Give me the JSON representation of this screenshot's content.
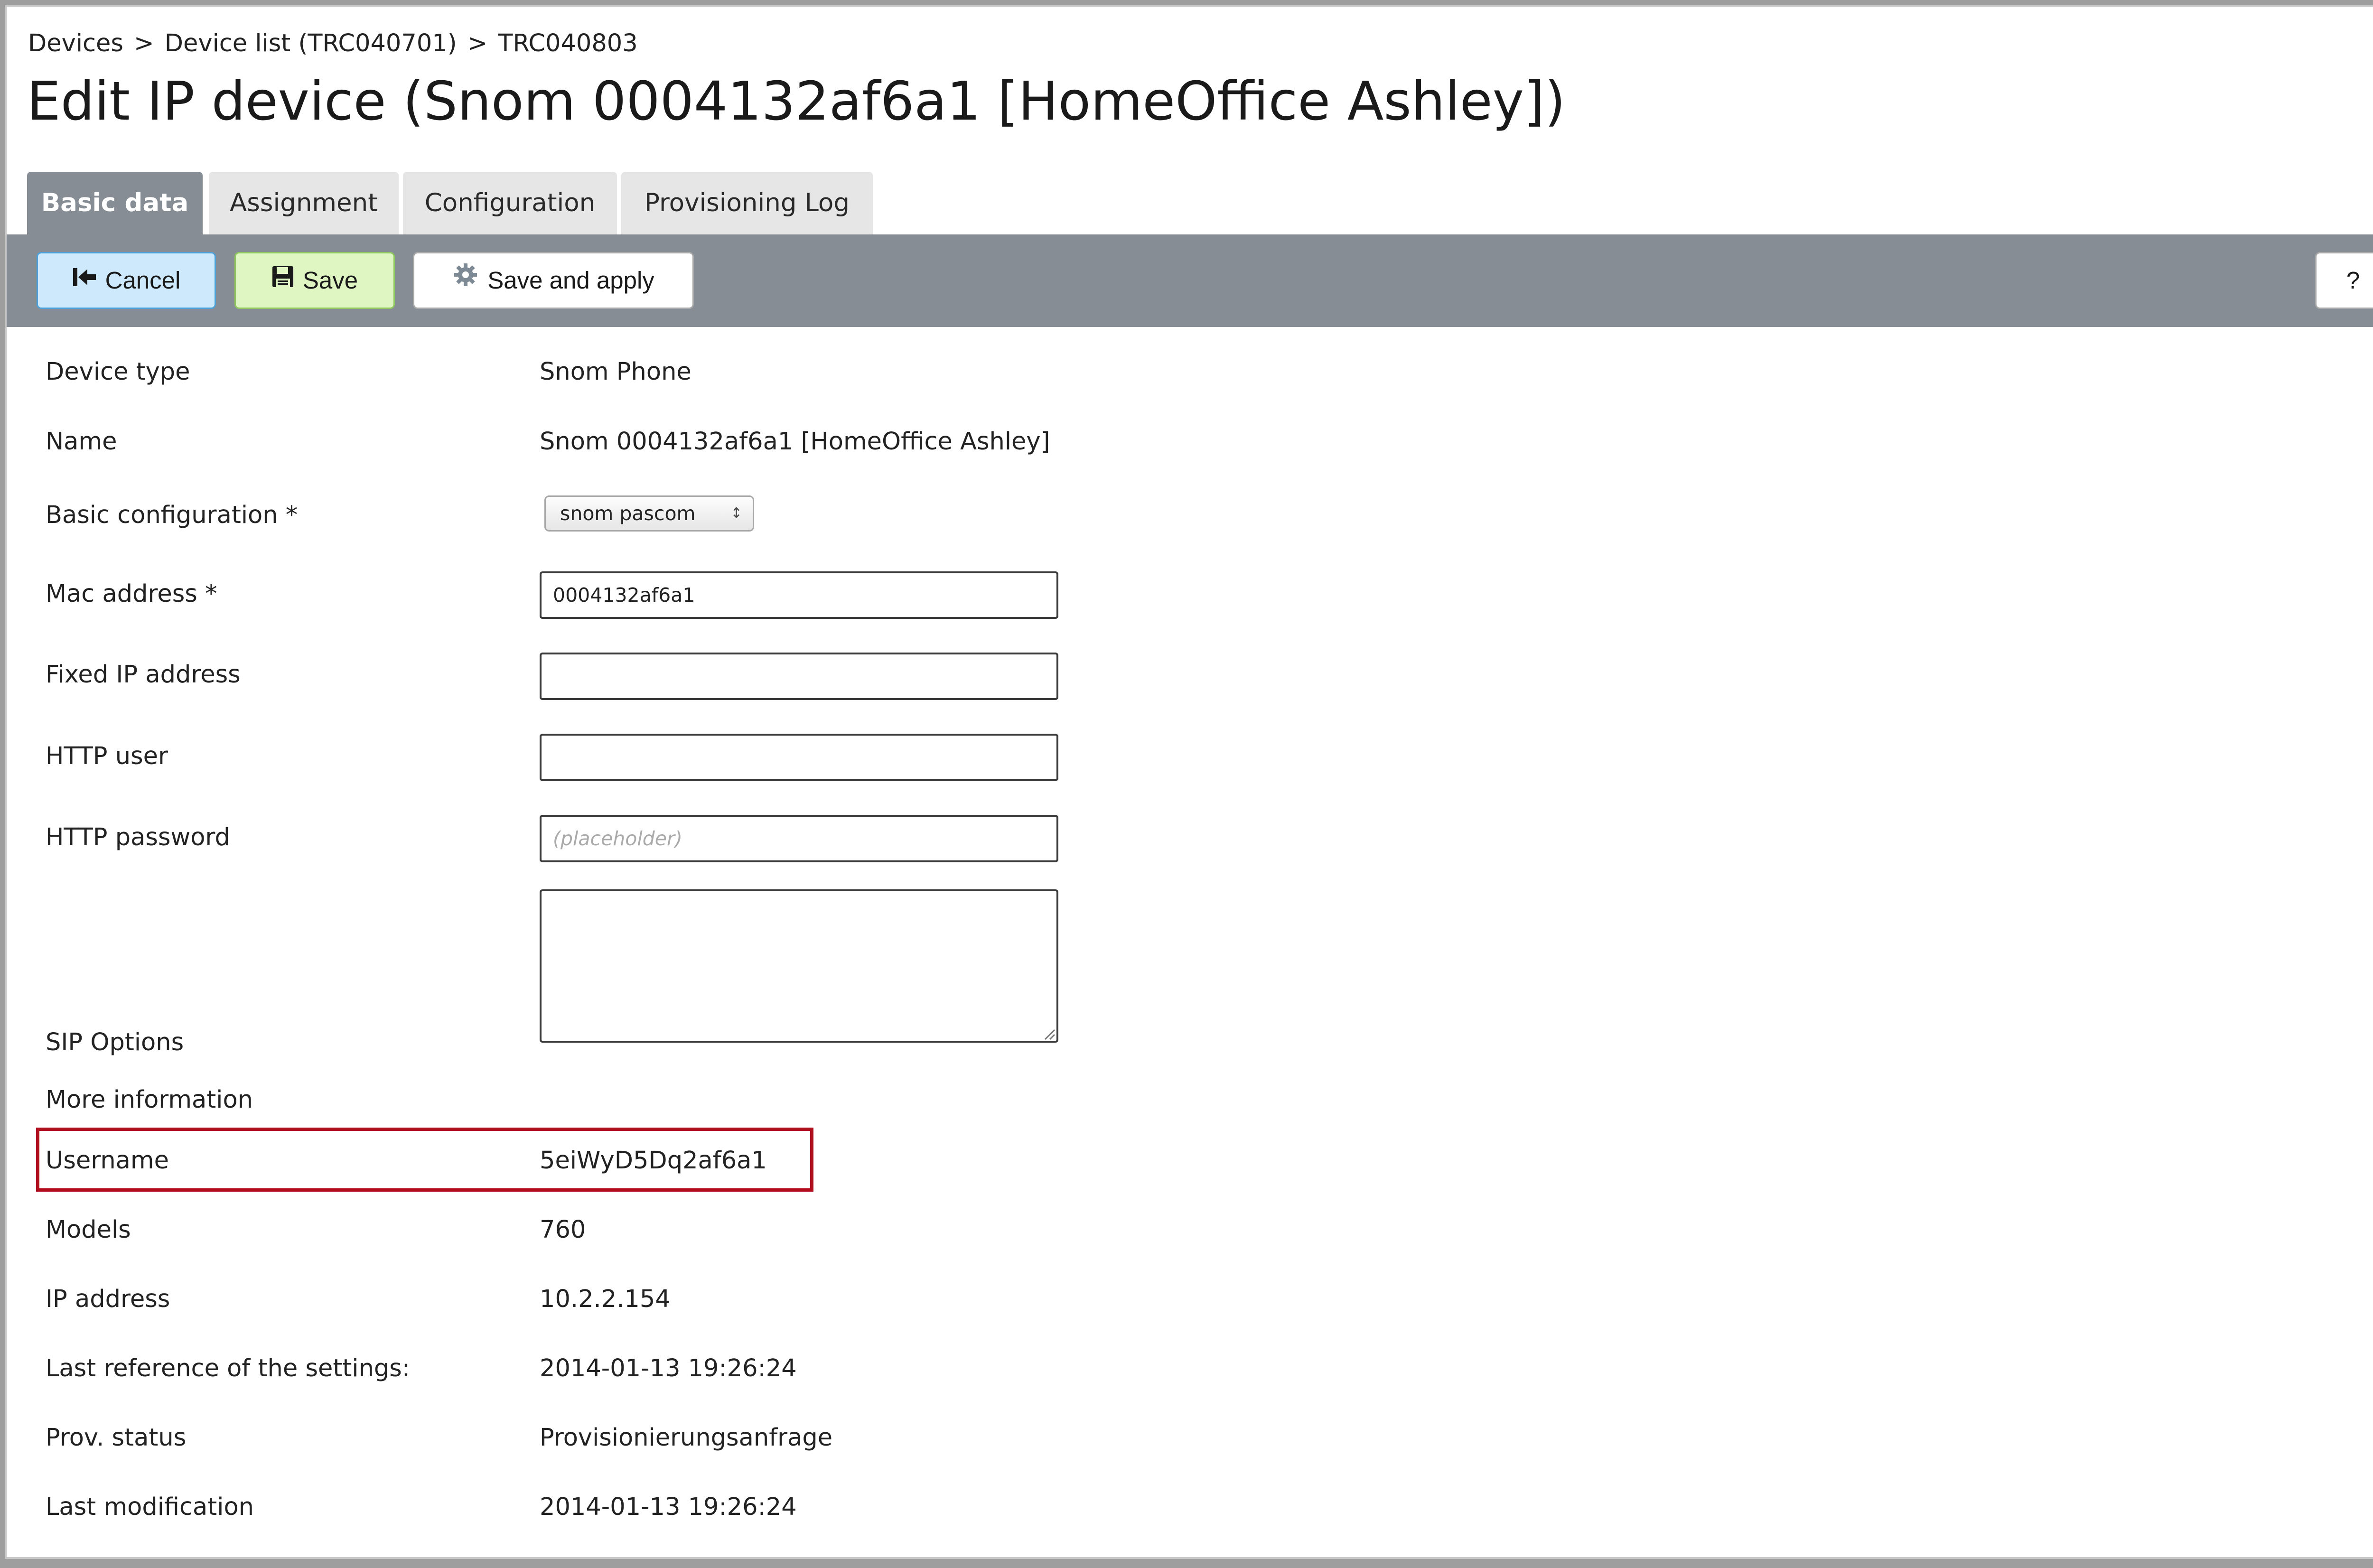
{
  "breadcrumb": [
    "Devices",
    "Device list (TRC040701)",
    "TRC040803"
  ],
  "breadcrumb_separator": ">",
  "page_title": "Edit IP device (Snom 0004132af6a1 [HomeOffice Ashley])",
  "tabs": [
    {
      "label": "Basic data",
      "active": true
    },
    {
      "label": "Assignment",
      "active": false
    },
    {
      "label": "Configuration",
      "active": false
    },
    {
      "label": "Provisioning Log",
      "active": false
    }
  ],
  "toolbar": {
    "cancel_label": "Cancel",
    "save_label": "Save",
    "save_apply_label": "Save and apply",
    "help_label": "?"
  },
  "form": {
    "device_type": {
      "label": "Device type",
      "value": "Snom Phone"
    },
    "name": {
      "label": "Name",
      "value": "Snom 0004132af6a1 [HomeOffice Ashley]"
    },
    "basic_configuration": {
      "label": "Basic configuration *",
      "selected": "snom pascom"
    },
    "mac_address": {
      "label": "Mac address *",
      "value": "0004132af6a1"
    },
    "fixed_ip": {
      "label": "Fixed IP address",
      "value": ""
    },
    "http_user": {
      "label": "HTTP user",
      "value": ""
    },
    "http_password": {
      "label": "HTTP password",
      "placeholder": "(placeholder)"
    },
    "sip_options": {
      "label": "SIP Options",
      "value": ""
    }
  },
  "info": {
    "heading": "More information",
    "username": {
      "label": "Username",
      "value": "5eiWyD5Dq2af6a1"
    },
    "models": {
      "label": "Models",
      "value": "760"
    },
    "ip_address": {
      "label": "IP address",
      "value": "10.2.2.154"
    },
    "last_reference": {
      "label": "Last reference of the settings:",
      "value": "2014-01-13 19:26:24"
    },
    "prov_status": {
      "label": "Prov. status",
      "value": "Provisionierungsanfrage"
    },
    "last_modification": {
      "label": "Last modification",
      "value": "2014-01-13 19:26:24"
    }
  },
  "colors": {
    "toolbar_bg": "#868d94",
    "highlight_border": "#b0101e",
    "cancel_bg": "#cde9fb",
    "save_bg": "#dff5c2"
  }
}
